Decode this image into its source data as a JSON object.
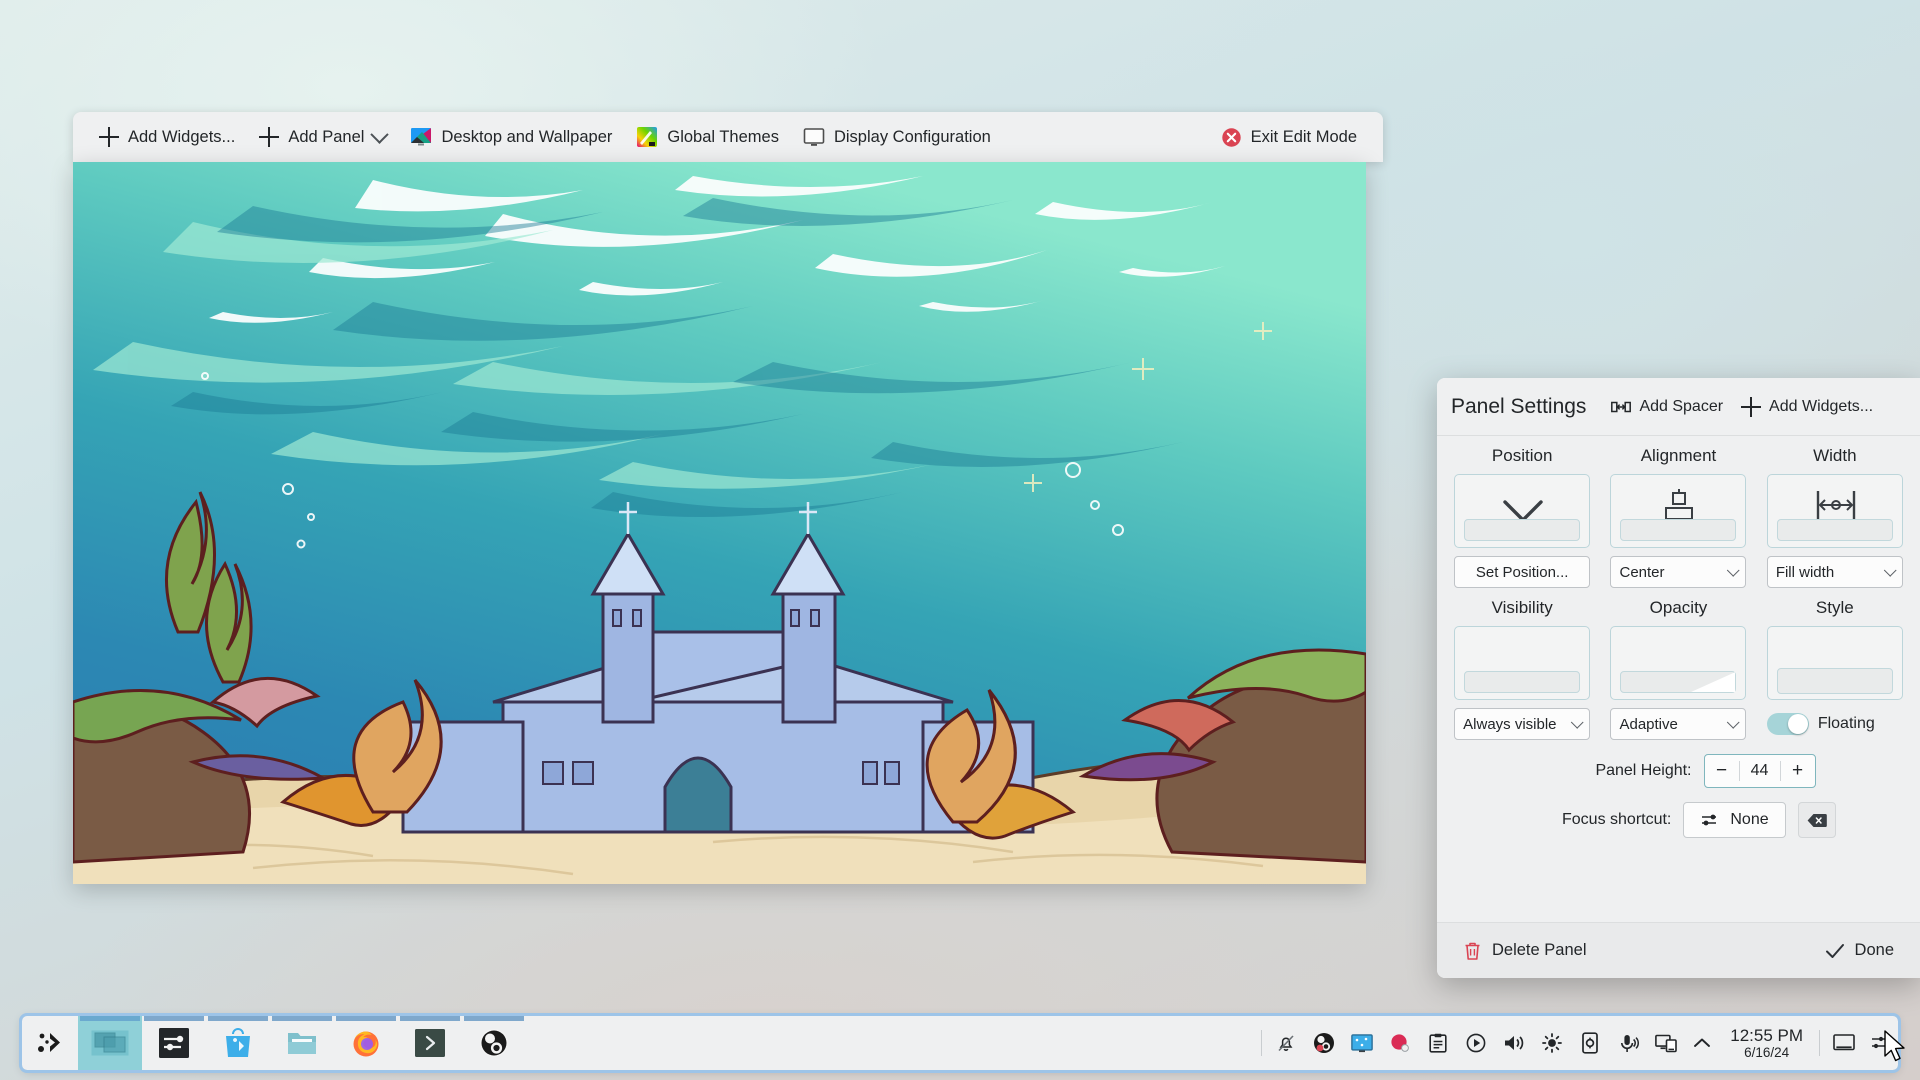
{
  "edit_toolbar": {
    "buttons": [
      {
        "label": "Add Widgets...",
        "icon": "plus-icon"
      },
      {
        "label": "Add Panel",
        "icon": "plus-icon",
        "has_menu": true
      },
      {
        "label": "Desktop and Wallpaper",
        "icon": "desktop-wallpaper-icon"
      },
      {
        "label": "Global Themes",
        "icon": "global-themes-icon"
      },
      {
        "label": "Display Configuration",
        "icon": "display-configuration-icon"
      }
    ],
    "exit": {
      "label": "Exit Edit Mode",
      "icon": "close-circle-icon"
    }
  },
  "panel_settings": {
    "title": "Panel Settings",
    "add_spacer": "Add Spacer",
    "add_widgets": "Add Widgets...",
    "groups": [
      {
        "title": "Position",
        "control_label": "Set Position...",
        "control_type": "button",
        "icon": "chevron-down-icon"
      },
      {
        "title": "Alignment",
        "control_label": "Center",
        "control_type": "combobox",
        "icon": "align-center-icon"
      },
      {
        "title": "Width",
        "control_label": "Fill width",
        "control_type": "combobox",
        "icon": "fill-width-icon"
      },
      {
        "title": "Visibility",
        "control_label": "Always visible",
        "control_type": "combobox",
        "icon": "visibility-icon"
      },
      {
        "title": "Opacity",
        "control_label": "Adaptive",
        "control_type": "combobox",
        "icon": "opacity-icon"
      },
      {
        "title": "Style",
        "control_label": "Floating",
        "control_type": "toggle",
        "icon": "style-icon",
        "toggle_on": true
      }
    ],
    "panel_height": {
      "label": "Panel Height:",
      "value": "44",
      "minus": "−",
      "plus": "+"
    },
    "focus_shortcut": {
      "label": "Focus shortcut:",
      "value": "None",
      "icon": "shortcut-icon",
      "clear_icon": "backspace-icon"
    },
    "delete_panel": "Delete Panel",
    "done": "Done",
    "accent_color": "#3daee9",
    "delete_color": "#da4453"
  },
  "taskbar": {
    "launcher": {
      "name": "kde-application-launcher"
    },
    "tasks": [
      {
        "name": "pager-task",
        "active": true
      },
      {
        "name": "system-settings-task",
        "active": false
      },
      {
        "name": "discover-task",
        "active": false
      },
      {
        "name": "file-manager-task",
        "active": false
      },
      {
        "name": "firefox-task",
        "active": false
      },
      {
        "name": "konsole-task",
        "active": false
      },
      {
        "name": "obs-studio-task",
        "active": false
      }
    ],
    "tray_icons": [
      "notifications-muted-icon",
      "obs-tray-icon",
      "display-tray-icon",
      "record-tray-icon",
      "clipboard-icon",
      "media-player-icon",
      "volume-icon",
      "brightness-icon",
      "battery-icon",
      "microphone-icon",
      "network-icon"
    ],
    "expand_icon": "chevron-up-icon",
    "clock": {
      "time": "12:55 PM",
      "date": "6/16/24"
    },
    "show_desktop_icon": "minimize-all-icon",
    "settings_icon": "panel-settings-icon"
  },
  "wallpaper": {
    "name": "underwater-castle-wallpaper",
    "colors": {
      "water_top": "#7fe0c8",
      "water_mid": "#37a9b6",
      "water_deep": "#2f7fb3",
      "sand": "#ecdcb4",
      "castle": "#9fb8e0",
      "seaweed": "#7a9c4a"
    }
  }
}
